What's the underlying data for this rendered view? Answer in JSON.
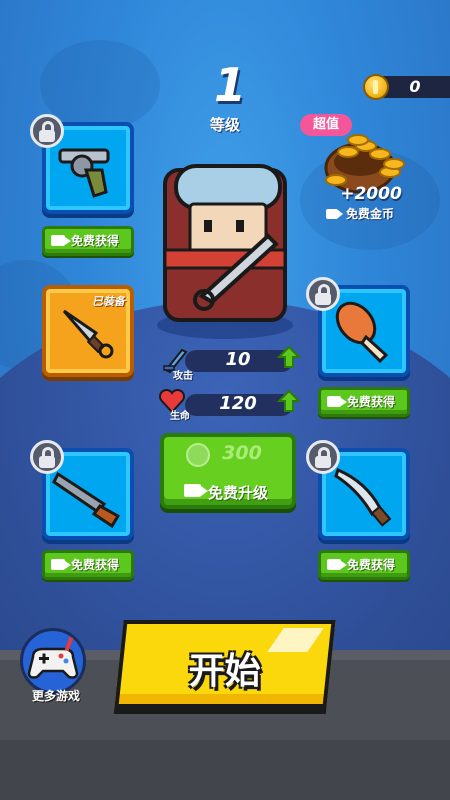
{
  "header": {
    "level_number": "1",
    "level_label": "等级",
    "coins": "0"
  },
  "promo": {
    "badge": "超值",
    "amount": "+2000",
    "label": "免费金币"
  },
  "slots": {
    "free_label": "免费获得",
    "equipped_label": "已装备",
    "items": [
      {
        "id": "revolver",
        "locked": true,
        "icon": "revolver-icon"
      },
      {
        "id": "kunai",
        "locked": false,
        "equipped": true,
        "icon": "kunai-icon"
      },
      {
        "id": "shotgun",
        "locked": true,
        "icon": "shotgun-icon"
      },
      {
        "id": "drumstick",
        "locked": true,
        "icon": "drumstick-icon"
      },
      {
        "id": "machete",
        "locked": true,
        "icon": "machete-icon"
      }
    ]
  },
  "stats": {
    "attack_label": "攻击",
    "attack_value": "10",
    "health_label": "生命",
    "health_value": "120"
  },
  "upgrade": {
    "cost": "300",
    "label": "免费升级"
  },
  "start": {
    "label": "开始"
  },
  "more_games": {
    "label": "更多游戏"
  },
  "colors": {
    "slot_blue": "#00a6f0",
    "slot_equipped": "#f5a21c",
    "free_green": "#5cc71c",
    "start_yellow": "#fbd80c",
    "promo_pink": "#f4569a"
  }
}
